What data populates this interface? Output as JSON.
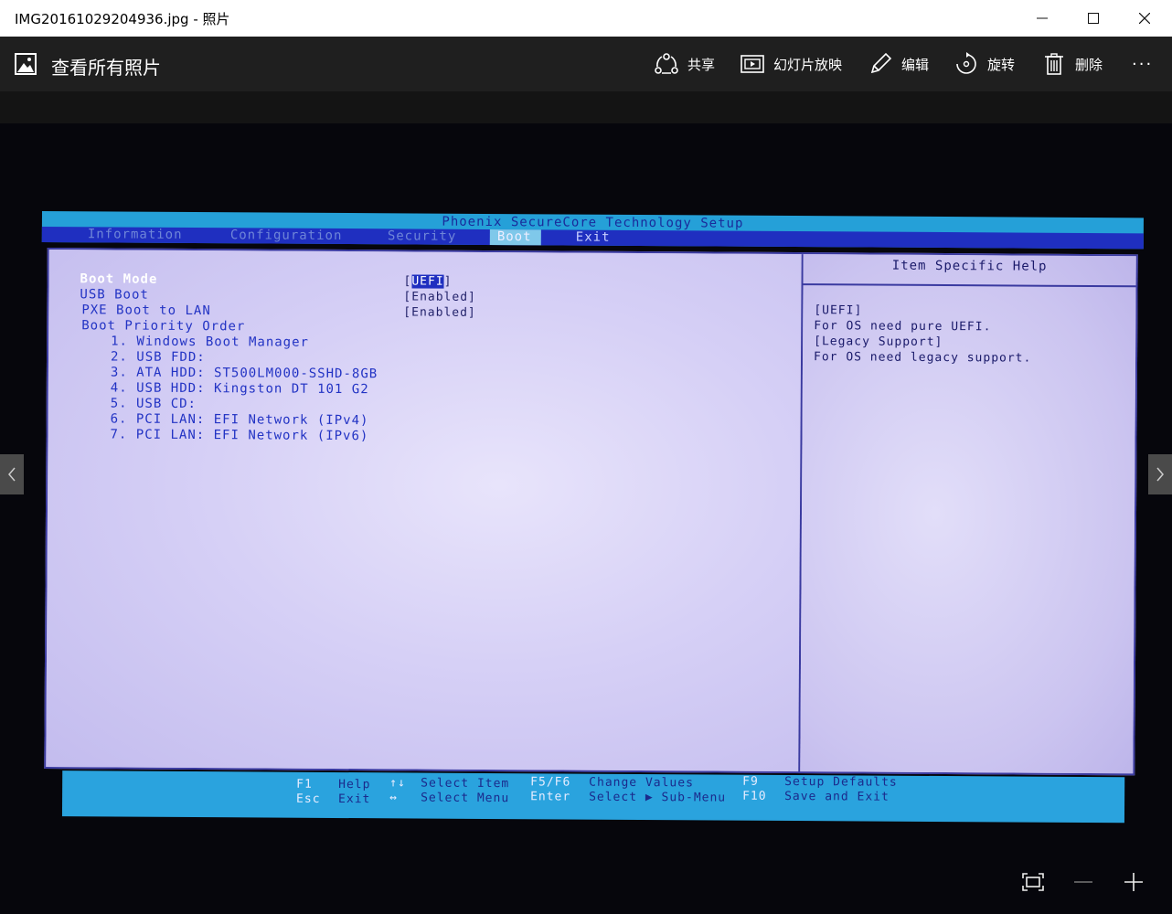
{
  "window": {
    "title": "IMG20161029204936.jpg - 照片",
    "minimize_icon": "minimize-icon",
    "maximize_icon": "maximize-icon",
    "close_icon": "close-icon"
  },
  "toolbar": {
    "view_all_label": "查看所有照片",
    "share_label": "共享",
    "slideshow_label": "幻灯片放映",
    "edit_label": "编辑",
    "rotate_label": "旋转",
    "delete_label": "删除",
    "more_label": "···"
  },
  "bios": {
    "title": "Phoenix SecureCore Technology Setup",
    "menu": [
      {
        "label": "Information"
      },
      {
        "label": "Configuration"
      },
      {
        "label": "Security"
      },
      {
        "label": "Boot"
      },
      {
        "label": "Exit"
      }
    ],
    "options": [
      {
        "label": "Boot Mode",
        "value": "UEFI"
      },
      {
        "label": "USB Boot",
        "value": "[Enabled]"
      },
      {
        "label": "PXE Boot to LAN",
        "value": "[Enabled]"
      }
    ],
    "priority_heading": "Boot Priority Order",
    "priority": [
      "1. Windows Boot Manager",
      "2. USB FDD:",
      "3. ATA HDD: ST500LM000-SSHD-8GB",
      "4. USB HDD: Kingston DT 101 G2",
      "5. USB CD:",
      "6. PCI LAN: EFI Network (IPv4)",
      "7. PCI LAN: EFI Network (IPv6)"
    ],
    "help_title": "Item Specific Help",
    "help_lines": [
      "[UEFI]",
      "For OS need pure UEFI.",
      "[Legacy Support]",
      "For OS need legacy support."
    ],
    "footer": {
      "f1": "F1",
      "help": "Help",
      "esc": "Esc",
      "exit": "Exit",
      "updown": "↑↓",
      "select_item": "Select Item",
      "leftright": "↔",
      "select_menu": "Select Menu",
      "f5f6": "F5/F6",
      "change_values": "Change Values",
      "enter": "Enter",
      "select_sub": "Select ▶ Sub-Menu",
      "f9": "F9",
      "setup_defaults": "Setup Defaults",
      "f10": "F10",
      "save_exit": "Save and Exit"
    }
  },
  "viewer": {
    "prev_icon": "chevron-left-icon",
    "next_icon": "chevron-right-icon",
    "fit_icon": "fit-to-window-icon",
    "zoom_out_icon": "zoom-out-icon",
    "zoom_in_icon": "zoom-in-icon"
  }
}
